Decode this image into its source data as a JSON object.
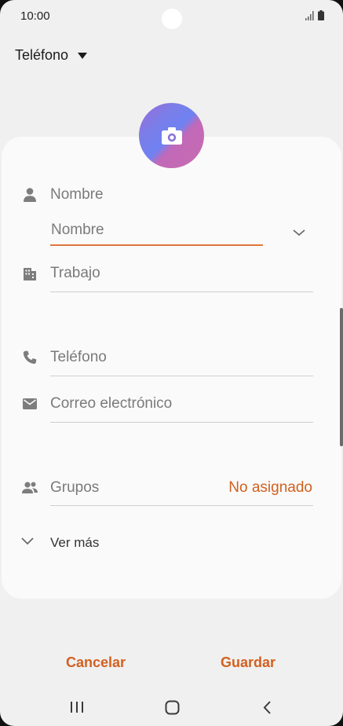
{
  "status_bar": {
    "time": "10:00",
    "icons": [
      "signal-icon",
      "battery-icon"
    ]
  },
  "account": {
    "label": "Teléfono",
    "icon": "dropdown-triangle-icon"
  },
  "avatar": {
    "icon": "camera-icon"
  },
  "fields": {
    "name_section_label": "Nombre",
    "name_input_placeholder": "Nombre",
    "work_label": "Trabajo",
    "phone_label": "Teléfono",
    "email_label": "Correo electrónico",
    "groups_label": "Grupos",
    "groups_value": "No asignado"
  },
  "see_more": "Ver más",
  "actions": {
    "cancel": "Cancelar",
    "save": "Guardar"
  },
  "colors": {
    "accent": "#d2601f",
    "input_active_line": "#e0763c",
    "background": "#f0f0f0",
    "card": "#fafafa"
  },
  "nav": [
    "recents-icon",
    "home-icon",
    "back-icon"
  ]
}
